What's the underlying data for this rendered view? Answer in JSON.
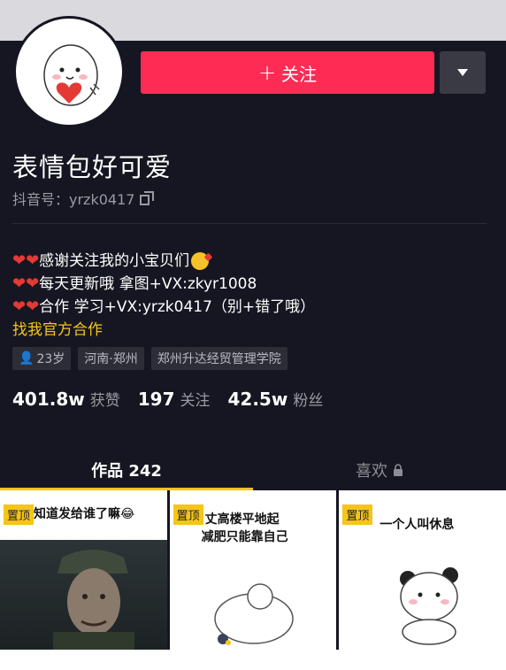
{
  "profile": {
    "name": "表情包好可爱",
    "douyin_id": "抖音号：yrzk0417",
    "follow_label": "关注",
    "follow_plus": "+"
  },
  "bio": {
    "line1": "感谢关注我的小宝贝们",
    "line2": "每天更新哦 拿图+VX:zkyr1008",
    "line3": "合作 学习+VX:yrzk0417（别+错了哦）",
    "link": "找我官方合作"
  },
  "tags": {
    "age": "23岁",
    "location": "河南·郑州",
    "school": "郑州升达经贸管理学院"
  },
  "stats": {
    "likes_num": "401.8w",
    "likes_label": "获赞",
    "following_num": "197",
    "following_label": "关注",
    "fans_num": "42.5w",
    "fans_label": "粉丝"
  },
  "tabs": {
    "works": "作品 242",
    "likes": "喜欢"
  },
  "grid": {
    "pin_label": "置顶",
    "item1_caption": "知道发给谁了嘛😂",
    "item2_caption_line1": "丈高楼平地起",
    "item2_caption_line2": "减肥只能靠自己",
    "item3_caption": "一个人叫休息"
  },
  "colors": {
    "accent": "#fe2c55",
    "highlight": "#f5c518",
    "background": "#161622"
  }
}
